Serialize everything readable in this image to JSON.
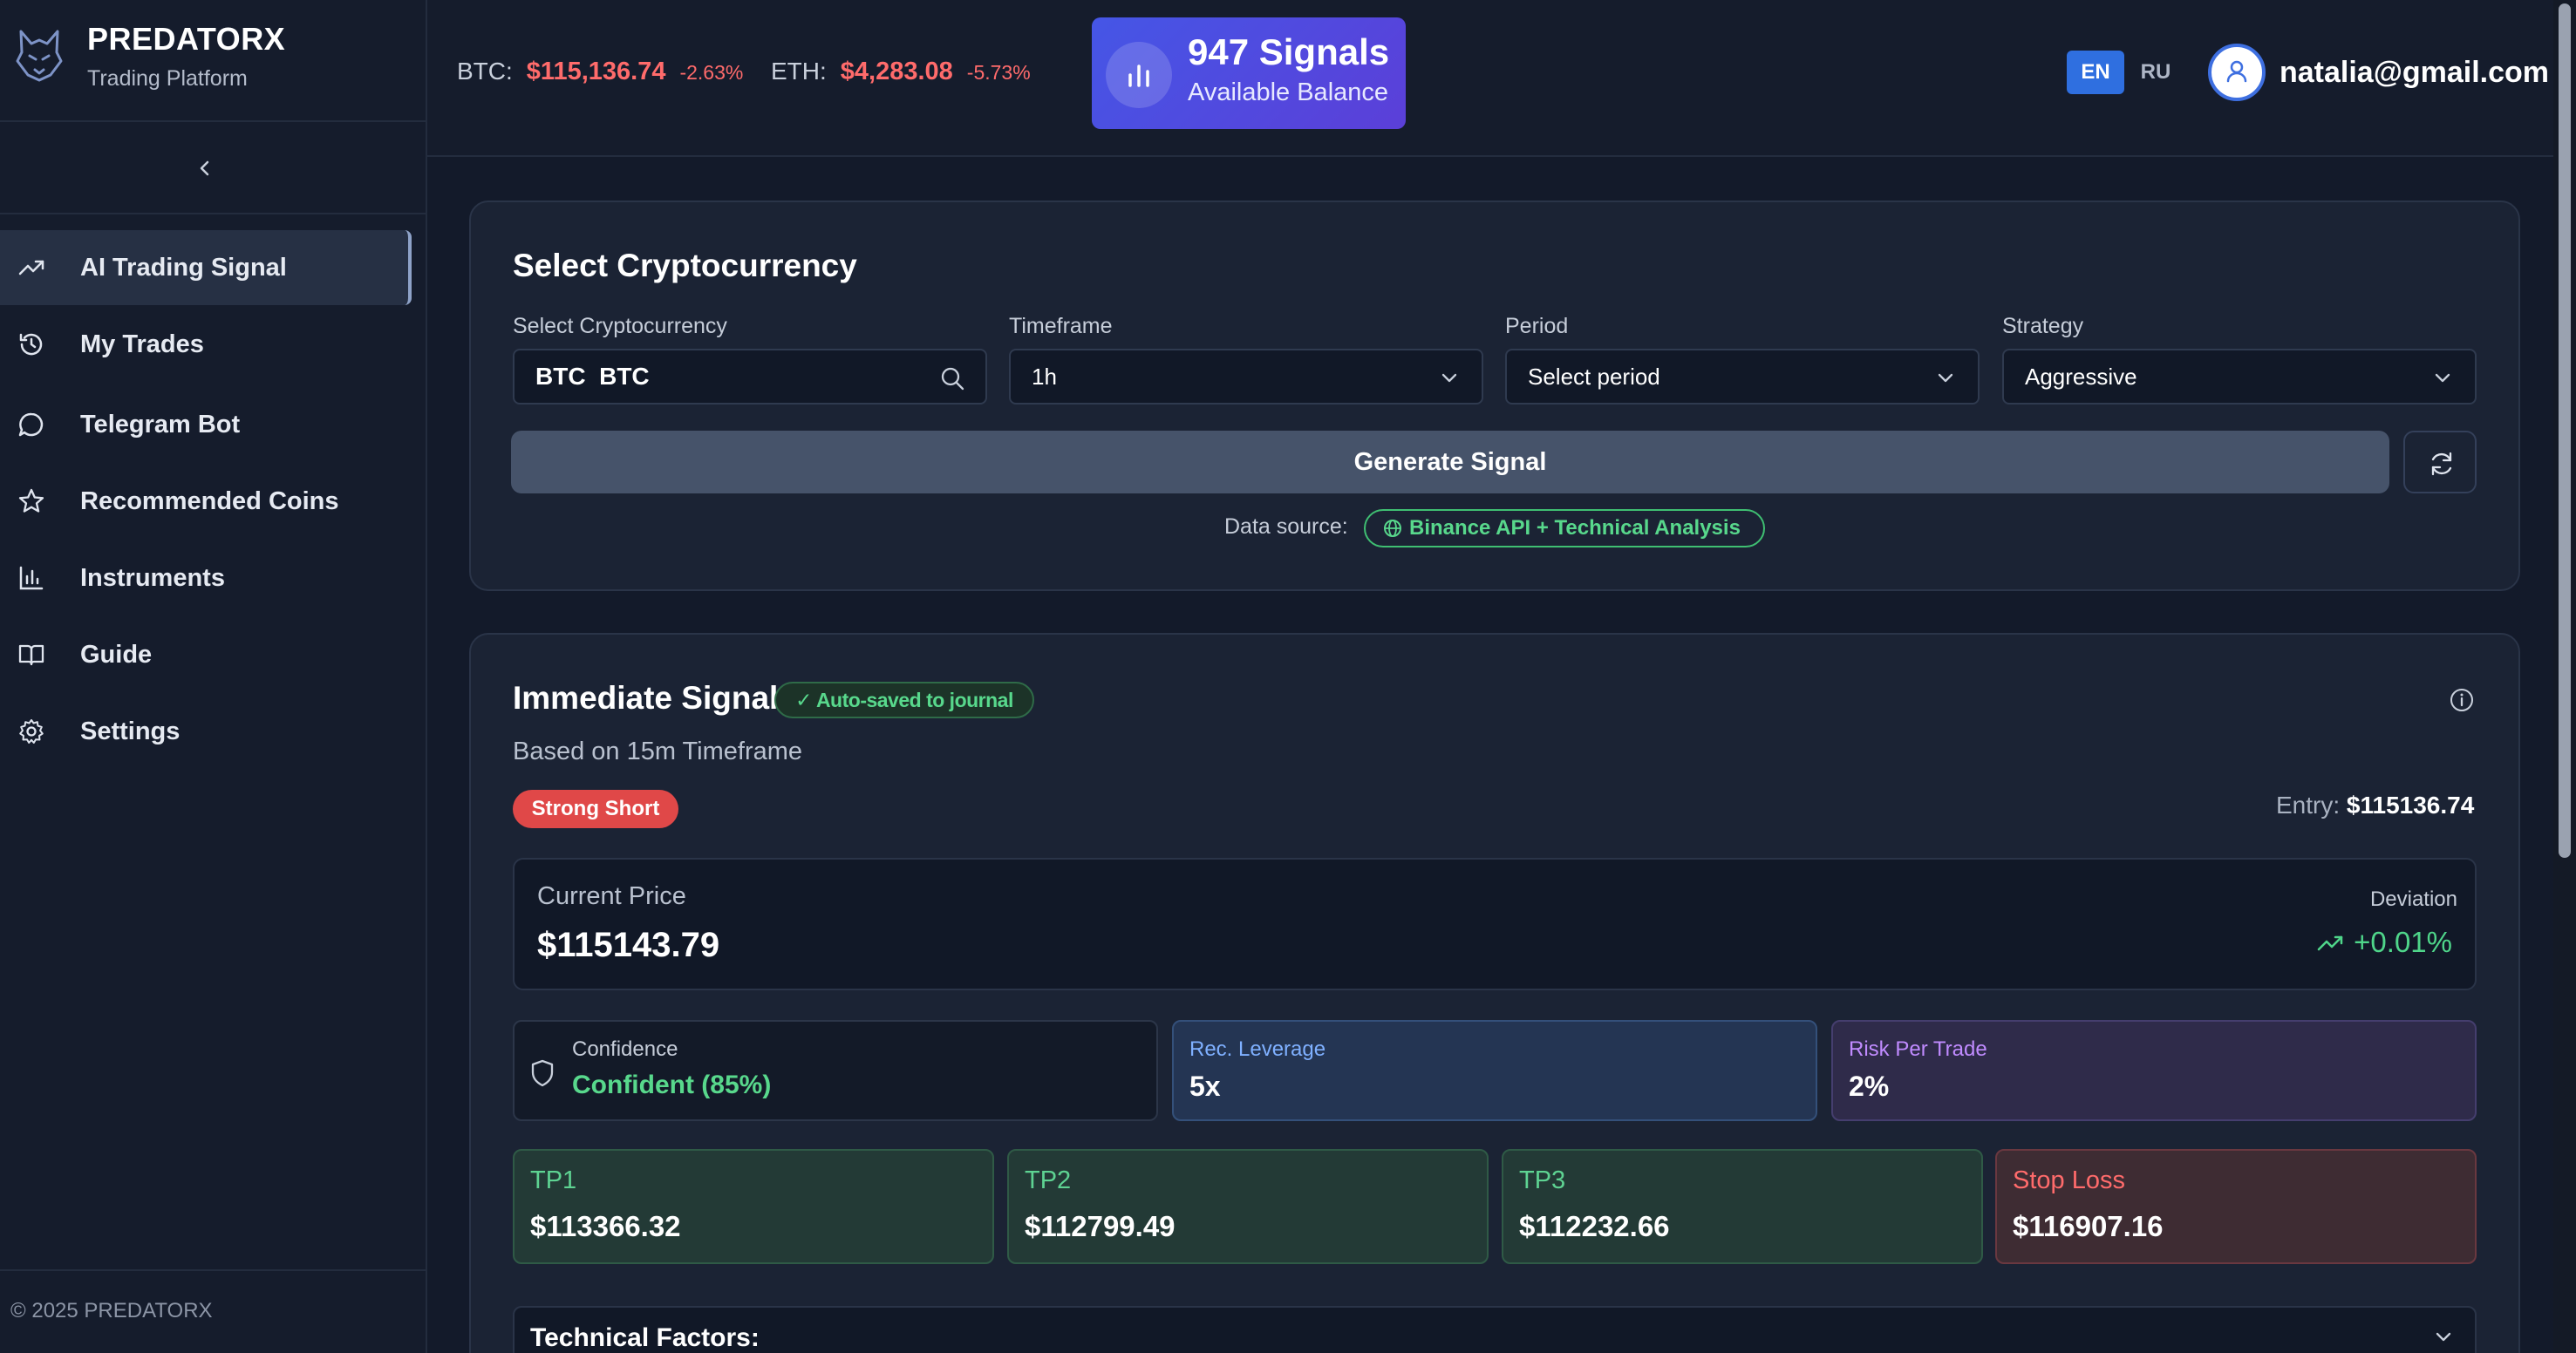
{
  "brand": {
    "name": "PREDATORX",
    "subtitle": "Trading Platform"
  },
  "sidebar": {
    "items": [
      {
        "label": "AI Trading Signal",
        "icon": "trending-up-icon",
        "active": true
      },
      {
        "label": "My Trades",
        "icon": "history-icon"
      },
      {
        "label": "Telegram Bot",
        "icon": "chat-bubble-icon"
      },
      {
        "label": "Recommended Coins",
        "icon": "star-icon"
      },
      {
        "label": "Instruments",
        "icon": "bar-chart-icon"
      },
      {
        "label": "Guide",
        "icon": "book-icon"
      },
      {
        "label": "Settings",
        "icon": "gear-icon"
      }
    ],
    "footer": "© 2025 PREDATORX"
  },
  "header": {
    "tickers": [
      {
        "symbol": "BTC:",
        "price": "$115,136.74",
        "change": "-2.63%"
      },
      {
        "symbol": "ETH:",
        "price": "$4,283.08",
        "change": "-5.73%"
      }
    ],
    "balance": {
      "title": "947 Signals",
      "subtitle": "Available Balance"
    },
    "languages": {
      "en": "EN",
      "ru": "RU",
      "active": "EN"
    },
    "user_email": "natalia@gmail.com"
  },
  "select_card": {
    "title": "Select Cryptocurrency",
    "crypto": {
      "label": "Select Cryptocurrency",
      "value": "BTC  BTC"
    },
    "timeframe": {
      "label": "Timeframe",
      "value": "1h"
    },
    "period": {
      "label": "Period",
      "value": "Select period"
    },
    "strategy": {
      "label": "Strategy",
      "value": "Aggressive"
    },
    "generate_label": "Generate Signal",
    "data_source_label": "Data source:",
    "data_source_value": "Binance API + Technical Analysis"
  },
  "signal_card": {
    "title": "Immediate Signal",
    "auto_saved": "✓ Auto-saved to journal",
    "based_on": "Based on 15m Timeframe",
    "signal_badge": "Strong Short",
    "entry_label": "Entry:",
    "entry_value": "$115136.74",
    "current_price_label": "Current Price",
    "current_price_value": "$115143.79",
    "deviation_label": "Deviation",
    "deviation_value": "+0.01%",
    "confidence_label": "Confidence",
    "confidence_value": "Confident (85%)",
    "leverage_label": "Rec. Leverage",
    "leverage_value": "5x",
    "risk_label": "Risk Per Trade",
    "risk_value": "2%",
    "targets": [
      {
        "label": "TP1",
        "value": "$113366.32"
      },
      {
        "label": "TP2",
        "value": "$112799.49"
      },
      {
        "label": "TP3",
        "value": "$112232.66"
      }
    ],
    "stop_loss": {
      "label": "Stop Loss",
      "value": "$116907.16"
    },
    "technical_factors_label": "Technical Factors:"
  },
  "colors": {
    "background": "#131a2a",
    "accent_blue": "#2f6fe0",
    "negative": "#ff6b6b",
    "positive": "#58d88c",
    "balance_gradient": "#4556e6"
  }
}
